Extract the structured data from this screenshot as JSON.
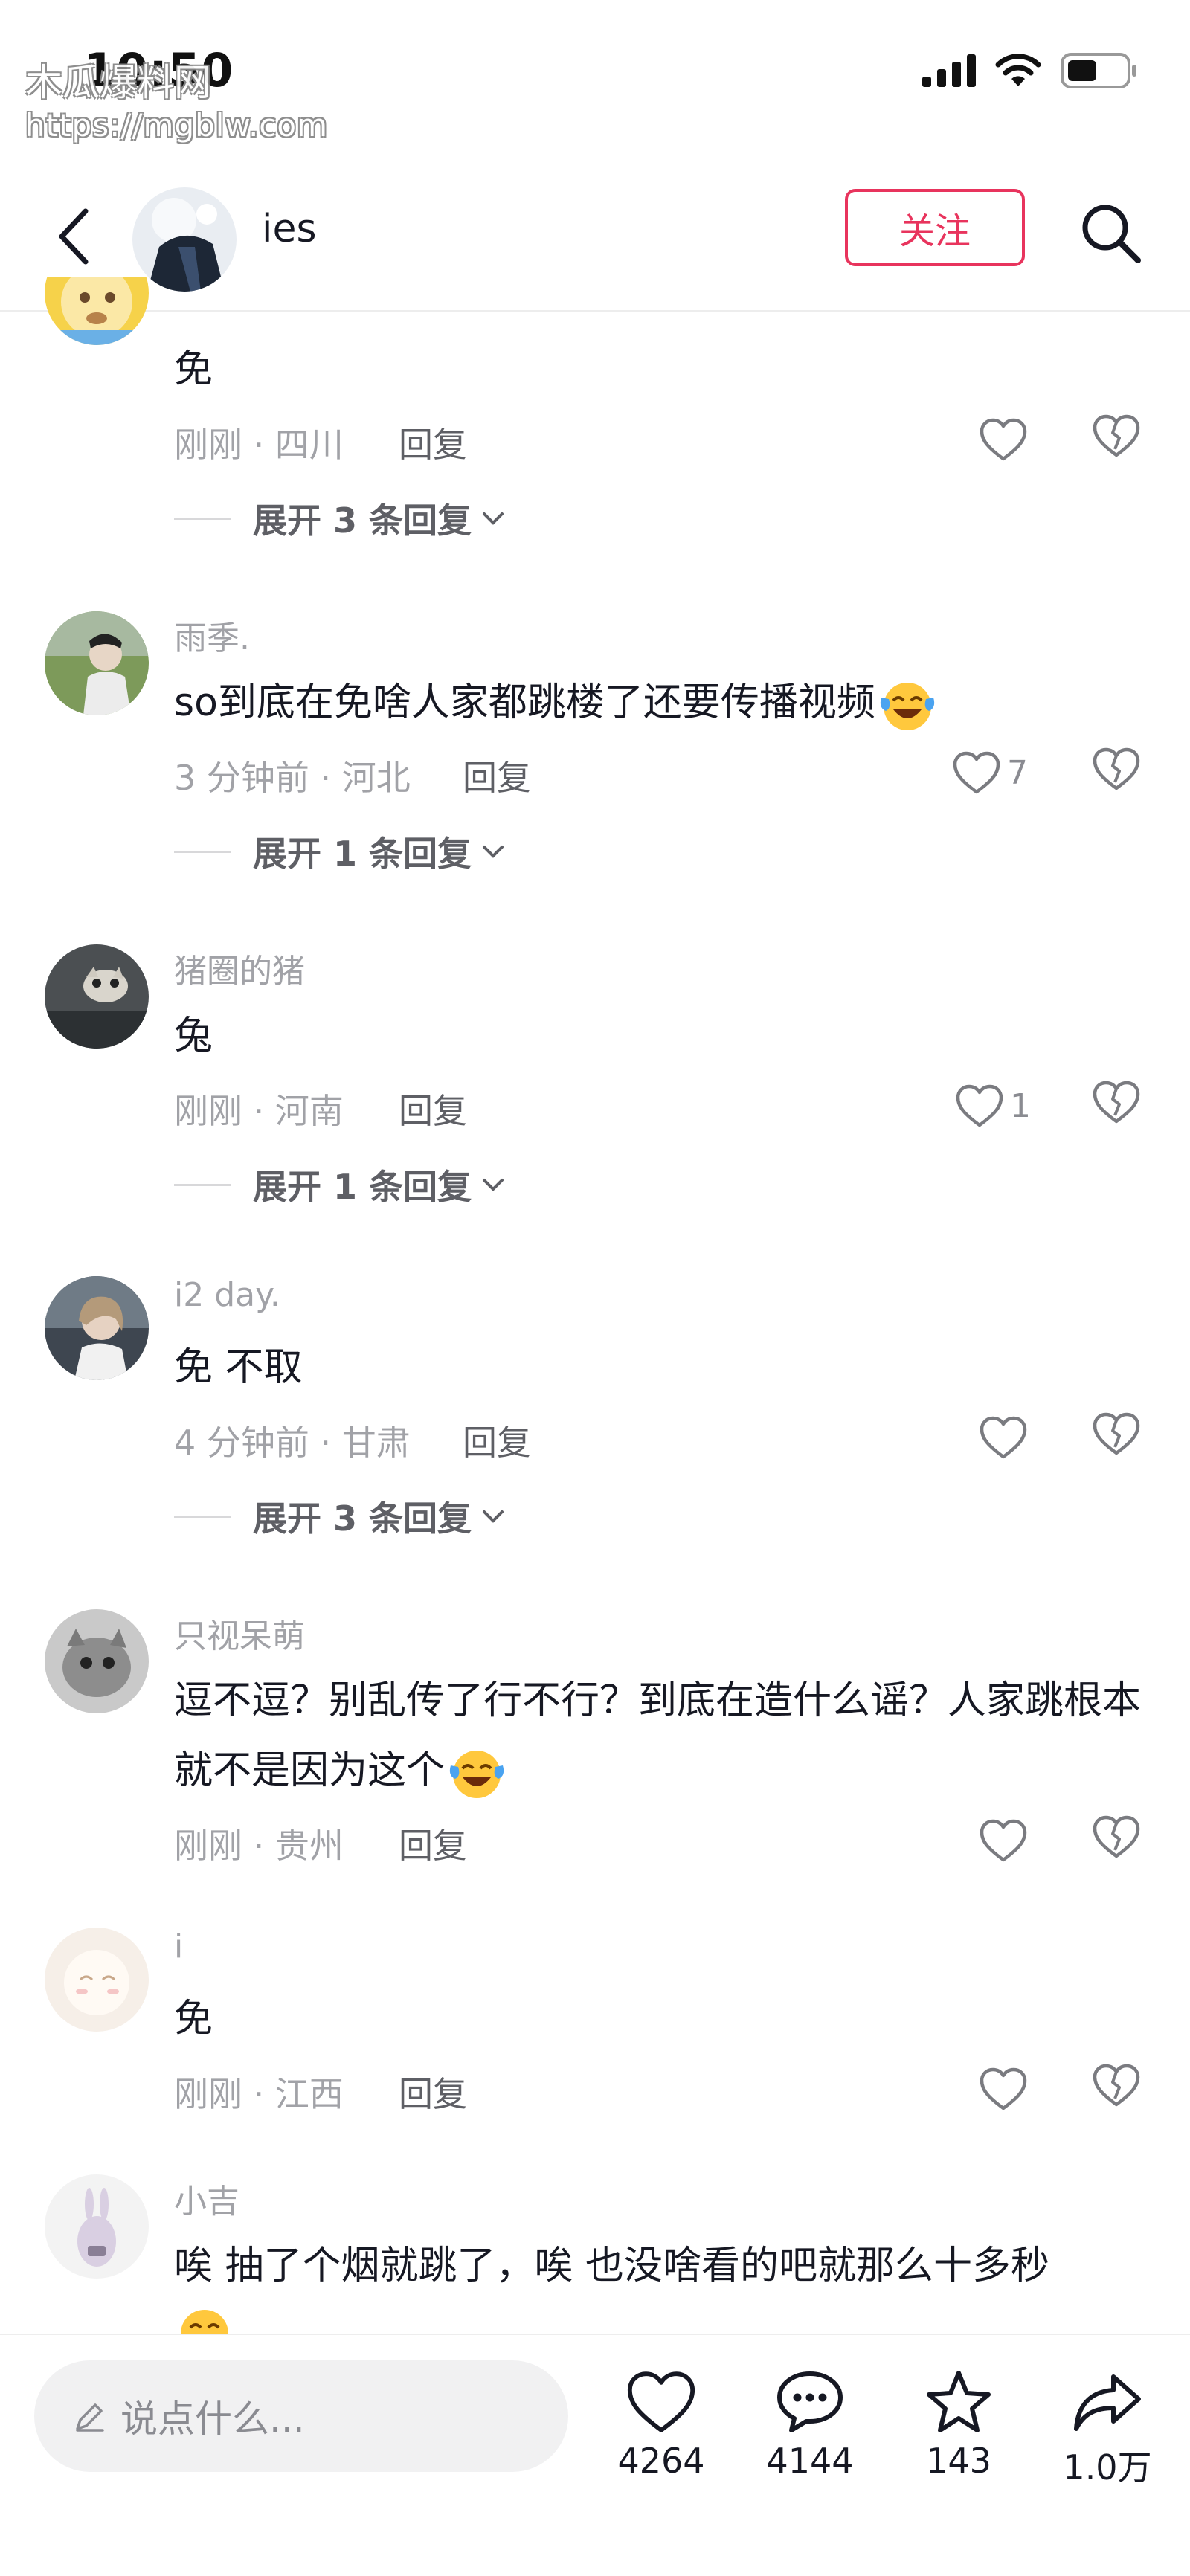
{
  "status_bar": {
    "time": "10:50"
  },
  "watermark": {
    "line1": "木瓜爆料网",
    "line2": "https://mgblw.com"
  },
  "header": {
    "name": "ies",
    "follow_label": "关注"
  },
  "comments": [
    {
      "username": "",
      "text": "免",
      "meta": "刚刚 · 四川",
      "reply": "回复",
      "likes": "",
      "expand": "展开 3 条回复"
    },
    {
      "username": "雨季.",
      "text": "so到底在免啥人家都跳楼了还要传播视频",
      "meta": "3 分钟前 · 河北",
      "reply": "回复",
      "likes": "7",
      "expand": "展开 1 条回复"
    },
    {
      "username": "猪圈的猪",
      "text": "兔",
      "meta": "刚刚 · 河南",
      "reply": "回复",
      "likes": "1",
      "expand": "展开 1 条回复"
    },
    {
      "username": "i2 day.",
      "text": "免 不取",
      "meta": "4 分钟前 · 甘肃",
      "reply": "回复",
      "likes": "",
      "expand": "展开 3 条回复"
    },
    {
      "username": "只视呆萌",
      "text": "逗不逗？别乱传了行不行？到底在造什么谣？人家跳根本就不是因为这个",
      "meta": "刚刚 · 贵州",
      "reply": "回复",
      "likes": "",
      "expand": ""
    },
    {
      "username": "i",
      "text": "免",
      "meta": "刚刚 · 江西",
      "reply": "回复",
      "likes": "",
      "expand": ""
    },
    {
      "username": "小吉",
      "text": "唉 抽了个烟就跳了，唉 也没啥看的吧就那么十多秒",
      "meta": "",
      "reply": "",
      "likes": "",
      "expand": ""
    }
  ],
  "bottom_bar": {
    "placeholder": "说点什么...",
    "likes": "4264",
    "comments": "4144",
    "favorites": "143",
    "shares": "1.0万"
  },
  "colors": {
    "accent": "#e8345d",
    "text": "#161823",
    "secondary": "#a1a2a7"
  },
  "icons": [
    "back-arrow-icon",
    "search-icon",
    "heart-icon",
    "broken-heart-icon",
    "chevron-down-icon",
    "pencil-icon",
    "chat-bubble-icon",
    "star-icon",
    "share-arrow-icon",
    "crying-laughing-emoji-icon"
  ]
}
